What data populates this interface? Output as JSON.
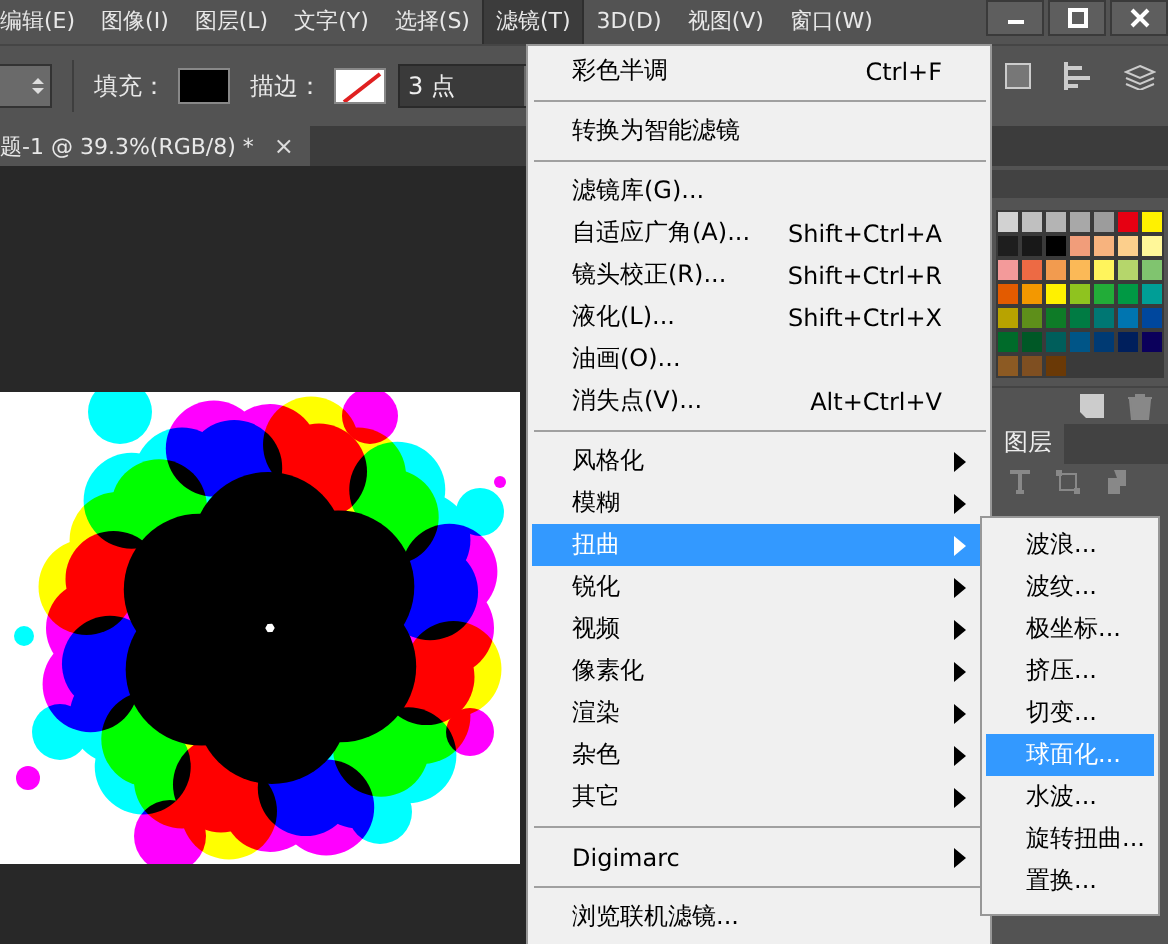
{
  "menubar": {
    "items": [
      {
        "label": "编辑(E)",
        "selected": false
      },
      {
        "label": "图像(I)",
        "selected": false
      },
      {
        "label": "图层(L)",
        "selected": false
      },
      {
        "label": "文字(Y)",
        "selected": false
      },
      {
        "label": "选择(S)",
        "selected": false
      },
      {
        "label": "滤镜(T)",
        "selected": true
      },
      {
        "label": "3D(D)",
        "selected": false
      },
      {
        "label": "视图(V)",
        "selected": false
      },
      {
        "label": "窗口(W)",
        "selected": false
      }
    ]
  },
  "options_bar": {
    "fill_label": "填充：",
    "stroke_label": "描边：",
    "stroke_width": "3 点"
  },
  "document_tab": {
    "title": "题-1 @ 39.3%(RGB/8) *",
    "close": "×"
  },
  "swatches": [
    {
      "color": "#d2d2d2"
    },
    {
      "color": "#c0c0c0"
    },
    {
      "color": "#b4b4b4"
    },
    {
      "color": "#a8a8a8"
    },
    {
      "color": "#9c9c9c"
    },
    {
      "color": "#e60012"
    },
    {
      "color": "#fff100"
    },
    {
      "color": "#1e1e1e"
    },
    {
      "color": "#181818"
    },
    {
      "color": "#000000"
    },
    {
      "color": "#f19d7a"
    },
    {
      "color": "#f7b37e"
    },
    {
      "color": "#fccf8c"
    },
    {
      "color": "#fff799"
    },
    {
      "color": "#f39a9a"
    },
    {
      "color": "#ed6a44"
    },
    {
      "color": "#f29b4f"
    },
    {
      "color": "#fbb957"
    },
    {
      "color": "#fff45c"
    },
    {
      "color": "#b5d66b"
    },
    {
      "color": "#80c46f"
    },
    {
      "color": "#e35b00"
    },
    {
      "color": "#f39800"
    },
    {
      "color": "#fff100"
    },
    {
      "color": "#8fc31f"
    },
    {
      "color": "#22ac38"
    },
    {
      "color": "#009944"
    },
    {
      "color": "#009e96"
    },
    {
      "color": "#b8a300"
    },
    {
      "color": "#5e8f1a"
    },
    {
      "color": "#0e7b27"
    },
    {
      "color": "#007b43"
    },
    {
      "color": "#007773"
    },
    {
      "color": "#0075b0"
    },
    {
      "color": "#00479d"
    },
    {
      "color": "#006b2a"
    },
    {
      "color": "#005826"
    },
    {
      "color": "#005e5b"
    },
    {
      "color": "#005587"
    },
    {
      "color": "#003a73"
    },
    {
      "color": "#001f5c"
    },
    {
      "color": "#0b005b"
    },
    {
      "color": "#8c5a23"
    },
    {
      "color": "#7f4f21"
    },
    {
      "color": "#6a3906"
    }
  ],
  "layers_panel": {
    "tab": "图层"
  },
  "filter_menu": {
    "items": [
      {
        "kind": "item",
        "label": "彩色半调",
        "shortcut": "Ctrl+F",
        "selected": false
      },
      {
        "kind": "separator"
      },
      {
        "kind": "item",
        "label": "转换为智能滤镜",
        "selected": false
      },
      {
        "kind": "separator"
      },
      {
        "kind": "item",
        "label": "滤镜库(G)...",
        "selected": false
      },
      {
        "kind": "item",
        "label": "自适应广角(A)...",
        "shortcut": "Shift+Ctrl+A",
        "selected": false
      },
      {
        "kind": "item",
        "label": "镜头校正(R)...",
        "shortcut": "Shift+Ctrl+R",
        "selected": false
      },
      {
        "kind": "item",
        "label": "液化(L)...",
        "shortcut": "Shift+Ctrl+X",
        "selected": false
      },
      {
        "kind": "item",
        "label": "油画(O)...",
        "selected": false
      },
      {
        "kind": "item",
        "label": "消失点(V)...",
        "shortcut": "Alt+Ctrl+V",
        "selected": false
      },
      {
        "kind": "separator"
      },
      {
        "kind": "submenu",
        "label": "风格化",
        "selected": false
      },
      {
        "kind": "submenu",
        "label": "模糊",
        "selected": false
      },
      {
        "kind": "submenu",
        "label": "扭曲",
        "selected": true
      },
      {
        "kind": "submenu",
        "label": "锐化",
        "selected": false
      },
      {
        "kind": "submenu",
        "label": "视频",
        "selected": false
      },
      {
        "kind": "submenu",
        "label": "像素化",
        "selected": false
      },
      {
        "kind": "submenu",
        "label": "渲染",
        "selected": false
      },
      {
        "kind": "submenu",
        "label": "杂色",
        "selected": false
      },
      {
        "kind": "submenu",
        "label": "其它",
        "selected": false
      },
      {
        "kind": "separator"
      },
      {
        "kind": "submenu",
        "label": "Digimarc",
        "selected": false
      },
      {
        "kind": "separator"
      },
      {
        "kind": "item",
        "label": "浏览联机滤镜...",
        "selected": false
      }
    ]
  },
  "distort_submenu": {
    "items": [
      {
        "label": "波浪...",
        "selected": false
      },
      {
        "label": "波纹...",
        "selected": false
      },
      {
        "label": "极坐标...",
        "selected": false
      },
      {
        "label": "挤压...",
        "selected": false
      },
      {
        "label": "切变...",
        "selected": false
      },
      {
        "label": "球面化...",
        "selected": true
      },
      {
        "label": "水波...",
        "selected": false
      },
      {
        "label": "旋转扭曲...",
        "selected": false
      },
      {
        "label": "置换...",
        "selected": false
      }
    ]
  }
}
